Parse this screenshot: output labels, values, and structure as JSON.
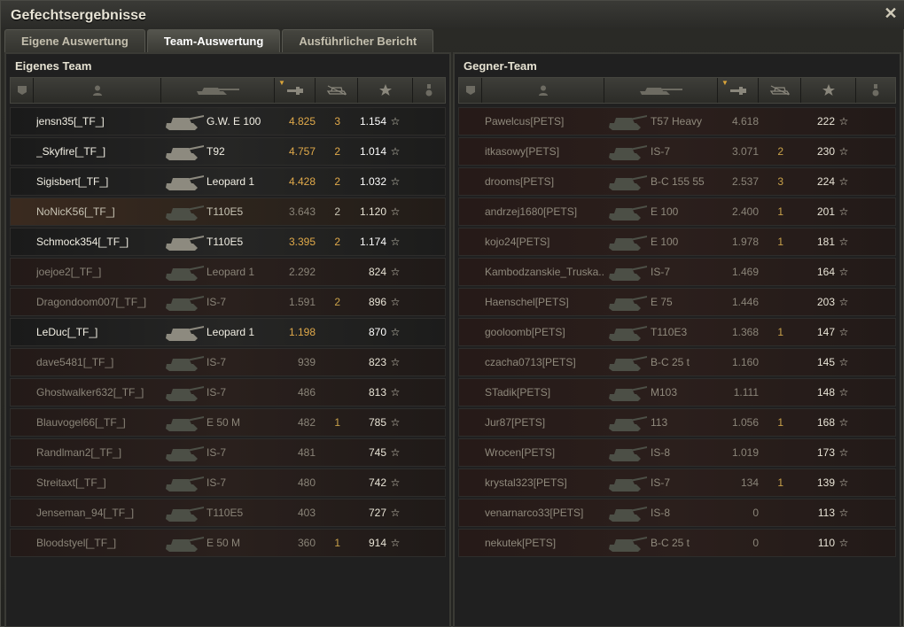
{
  "window": {
    "title": "Gefechtsergebnisse",
    "close_icon": "close-icon"
  },
  "tabs": [
    {
      "label": "Eigene Auswertung",
      "active": false
    },
    {
      "label": "Team-Auswertung",
      "active": true
    },
    {
      "label": "Ausführlicher Bericht",
      "active": false
    }
  ],
  "own_team": {
    "title": "Eigenes Team",
    "columns": [
      "squad-icon",
      "player-icon",
      "tank-icon",
      "damage-icon",
      "kills-icon",
      "xp-star-icon",
      "medal-icon"
    ],
    "rows": [
      {
        "name": "jensn35[_TF_]",
        "tank": "G.W. E 100",
        "damage": "4.825",
        "kills": "3",
        "xp": "1.154",
        "state": "alive"
      },
      {
        "name": "_Skyfire[_TF_]",
        "tank": "T92",
        "damage": "4.757",
        "kills": "2",
        "xp": "1.014",
        "state": "alive"
      },
      {
        "name": "Sigisbert[_TF_]",
        "tank": "Leopard 1",
        "damage": "4.428",
        "kills": "2",
        "xp": "1.032",
        "state": "alive"
      },
      {
        "name": "NoNicK56[_TF_]",
        "tank": "T110E5",
        "damage": "3.643",
        "kills": "2",
        "xp": "1.120",
        "state": "highlight"
      },
      {
        "name": "Schmock354[_TF_]",
        "tank": "T110E5",
        "damage": "3.395",
        "kills": "2",
        "xp": "1.174",
        "state": "alive"
      },
      {
        "name": "joejoe2[_TF_]",
        "tank": "Leopard 1",
        "damage": "2.292",
        "kills": "",
        "xp": "824",
        "state": "dead"
      },
      {
        "name": "Dragondoom007[_TF_]",
        "tank": "IS-7",
        "damage": "1.591",
        "kills": "2",
        "xp": "896",
        "state": "dead"
      },
      {
        "name": "LeDuc[_TF_]",
        "tank": "Leopard 1",
        "damage": "1.198",
        "kills": "",
        "xp": "870",
        "state": "alive"
      },
      {
        "name": "dave5481[_TF_]",
        "tank": "IS-7",
        "damage": "939",
        "kills": "",
        "xp": "823",
        "state": "dead"
      },
      {
        "name": "Ghostwalker632[_TF_]",
        "tank": "IS-7",
        "damage": "486",
        "kills": "",
        "xp": "813",
        "state": "dead"
      },
      {
        "name": "Blauvogel66[_TF_]",
        "tank": "E 50 M",
        "damage": "482",
        "kills": "1",
        "xp": "785",
        "state": "dead"
      },
      {
        "name": "Randlman2[_TF_]",
        "tank": "IS-7",
        "damage": "481",
        "kills": "",
        "xp": "745",
        "state": "dead"
      },
      {
        "name": "Streitaxt[_TF_]",
        "tank": "IS-7",
        "damage": "480",
        "kills": "",
        "xp": "742",
        "state": "dead"
      },
      {
        "name": "Jenseman_94[_TF_]",
        "tank": "T110E5",
        "damage": "403",
        "kills": "",
        "xp": "727",
        "state": "dead"
      },
      {
        "name": "Bloodstyel[_TF_]",
        "tank": "E 50 M",
        "damage": "360",
        "kills": "1",
        "xp": "914",
        "state": "dead"
      }
    ]
  },
  "enemy_team": {
    "title": "Gegner-Team",
    "rows": [
      {
        "name": "Pawelcus[PETS]",
        "tank": "T57 Heavy",
        "damage": "4.618",
        "kills": "",
        "xp": "222"
      },
      {
        "name": "itkasowy[PETS]",
        "tank": "IS-7",
        "damage": "3.071",
        "kills": "2",
        "xp": "230"
      },
      {
        "name": "drooms[PETS]",
        "tank": "B-C 155 55",
        "damage": "2.537",
        "kills": "3",
        "xp": "224"
      },
      {
        "name": "andrzej1680[PETS]",
        "tank": "E 100",
        "damage": "2.400",
        "kills": "1",
        "xp": "201"
      },
      {
        "name": "kojo24[PETS]",
        "tank": "E 100",
        "damage": "1.978",
        "kills": "1",
        "xp": "181"
      },
      {
        "name": "Kambodzanskie_Truska..",
        "tank": "IS-7",
        "damage": "1.469",
        "kills": "",
        "xp": "164"
      },
      {
        "name": "Haenschel[PETS]",
        "tank": "E 75",
        "damage": "1.446",
        "kills": "",
        "xp": "203"
      },
      {
        "name": "gooloomb[PETS]",
        "tank": "T110E3",
        "damage": "1.368",
        "kills": "1",
        "xp": "147"
      },
      {
        "name": "czacha0713[PETS]",
        "tank": "B-C 25 t",
        "damage": "1.160",
        "kills": "",
        "xp": "145"
      },
      {
        "name": "STadik[PETS]",
        "tank": "M103",
        "damage": "1.111",
        "kills": "",
        "xp": "148"
      },
      {
        "name": "Jur87[PETS]",
        "tank": "113",
        "damage": "1.056",
        "kills": "1",
        "xp": "168"
      },
      {
        "name": "Wrocen[PETS]",
        "tank": "IS-8",
        "damage": "1.019",
        "kills": "",
        "xp": "173"
      },
      {
        "name": "krystal323[PETS]",
        "tank": "IS-7",
        "damage": "134",
        "kills": "1",
        "xp": "139"
      },
      {
        "name": "venarnarco33[PETS]",
        "tank": "IS-8",
        "damage": "0",
        "kills": "",
        "xp": "113"
      },
      {
        "name": "nekutek[PETS]",
        "tank": "B-C 25 t",
        "damage": "0",
        "kills": "",
        "xp": "110"
      }
    ]
  },
  "star_glyph": "☆",
  "colors": {
    "accent": "#e0a94a",
    "bg": "#202020"
  }
}
